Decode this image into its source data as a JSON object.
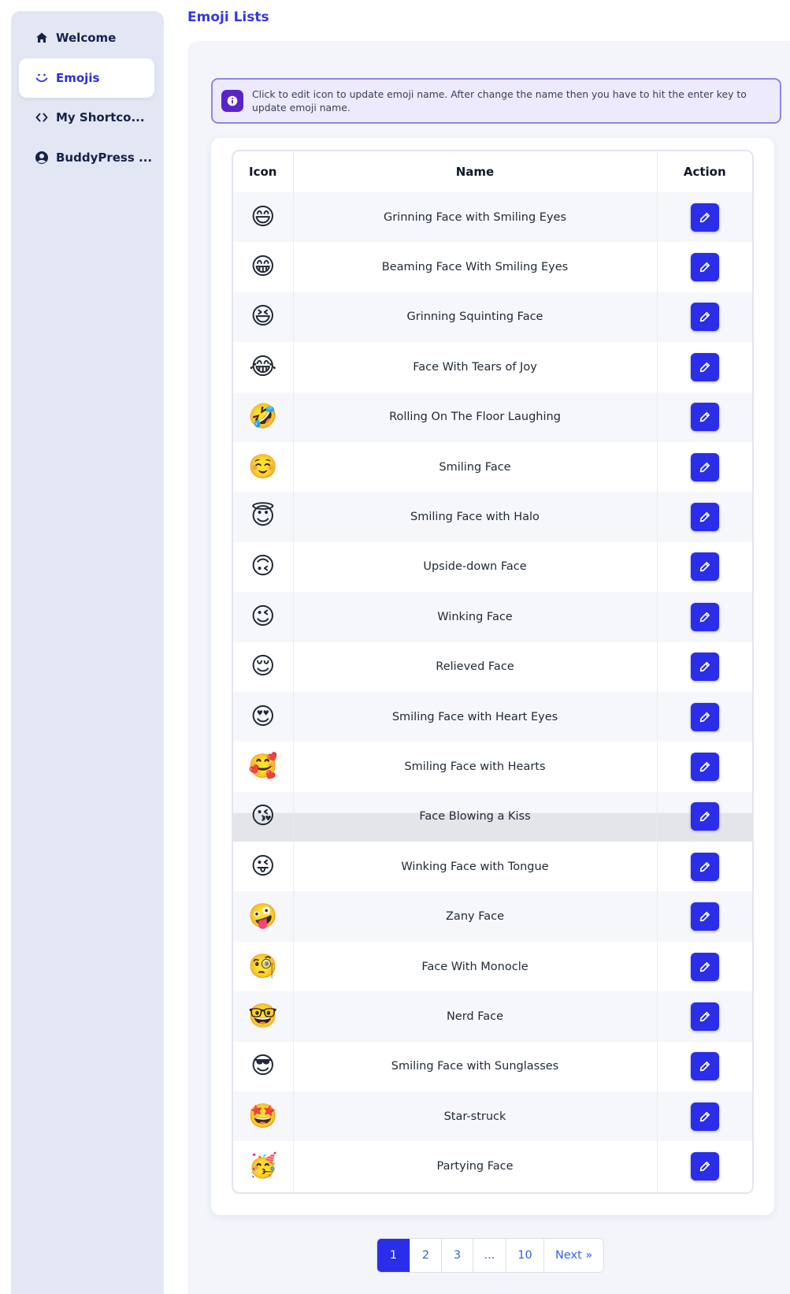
{
  "sidebar": {
    "items": [
      {
        "label": "Welcome",
        "icon": "home-icon",
        "active": false
      },
      {
        "label": "Emojis",
        "icon": "smile-icon",
        "active": true
      },
      {
        "label": "My Shortco...",
        "icon": "code-icon",
        "active": false
      },
      {
        "label": "BuddyPress ...",
        "icon": "user-circle-icon",
        "active": false
      }
    ]
  },
  "header": {
    "title": "Emoji Lists"
  },
  "notice": {
    "icon": "info-icon",
    "text": "Click to edit icon to update emoji name. After change the name then you have to hit the enter key to update emoji name."
  },
  "table": {
    "headers": [
      "Icon",
      "Name",
      "Action"
    ],
    "rows": [
      {
        "icon": "😄",
        "name": "Grinning Face with Smiling Eyes"
      },
      {
        "icon": "😁",
        "name": "Beaming Face With Smiling Eyes"
      },
      {
        "icon": "😆",
        "name": "Grinning Squinting Face"
      },
      {
        "icon": "😂",
        "name": "Face With Tears of Joy"
      },
      {
        "icon": "🤣",
        "name": "Rolling On The Floor Laughing"
      },
      {
        "icon": "☺️",
        "name": "Smiling Face"
      },
      {
        "icon": "😇",
        "name": "Smiling Face with Halo"
      },
      {
        "icon": "🙃",
        "name": "Upside-down Face"
      },
      {
        "icon": "😉",
        "name": "Winking Face"
      },
      {
        "icon": "😌",
        "name": "Relieved Face"
      },
      {
        "icon": "😍",
        "name": "Smiling Face with Heart Eyes"
      },
      {
        "icon": "🥰",
        "name": "Smiling Face with Hearts"
      },
      {
        "icon": "😘",
        "name": "Face Blowing a Kiss"
      },
      {
        "icon": "😜",
        "name": "Winking Face with Tongue"
      },
      {
        "icon": "🤪",
        "name": "Zany Face"
      },
      {
        "icon": "🧐",
        "name": "Face With Monocle"
      },
      {
        "icon": "🤓",
        "name": "Nerd Face"
      },
      {
        "icon": "😎",
        "name": "Smiling Face with Sunglasses"
      },
      {
        "icon": "🤩",
        "name": "Star-struck"
      },
      {
        "icon": "🥳",
        "name": "Partying Face"
      }
    ],
    "action_icon": "pencil-icon"
  },
  "pagination": {
    "pages": [
      "1",
      "2",
      "3",
      "...",
      "10",
      "Next »"
    ],
    "current": "1"
  },
  "colors": {
    "accent": "#2a2ee8",
    "title": "#3437e6",
    "sidebar_bg": "#e3e7f4",
    "notice_bg": "#eceafc",
    "notice_border": "#8c86ea"
  }
}
